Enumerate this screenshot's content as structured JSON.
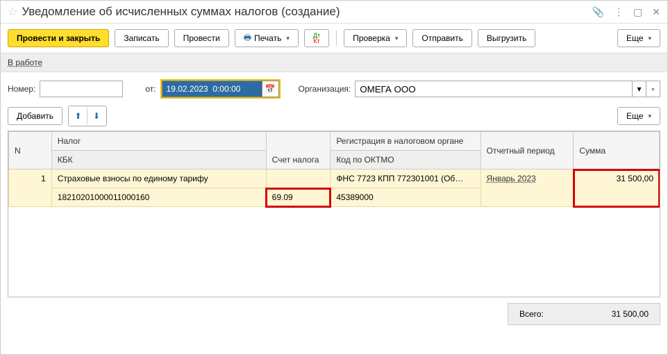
{
  "title": "Уведомление об исчисленных суммах налогов (создание)",
  "toolbar": {
    "submit_close": "Провести и закрыть",
    "save": "Записать",
    "submit": "Провести",
    "print": "Печать",
    "check": "Проверка",
    "send": "Отправить",
    "export": "Выгрузить",
    "more": "Еще"
  },
  "status": {
    "in_work": "В работе"
  },
  "fields": {
    "number_label": "Номер:",
    "number_value": "",
    "from_label": "от:",
    "date_value": "19.02.2023  0:00:00",
    "org_label": "Организация:",
    "org_value": "ОМЕГА ООО"
  },
  "tabletools": {
    "add": "Добавить",
    "more": "Еще"
  },
  "headers": {
    "n": "N",
    "tax": "Налог",
    "kbk": "КБК",
    "acct": "Счет налога",
    "reg": "Регистрация в налоговом органе",
    "oktmo": "Код по ОКТМО",
    "period": "Отчетный период",
    "sum": "Сумма"
  },
  "rows": [
    {
      "n": "1",
      "tax": "Страховые взносы по единому тарифу",
      "kbk": "18210201000011000160",
      "acct": "69.09",
      "reg": "ФНС 7723 КПП 772301001 (Об…",
      "oktmo": "45389000",
      "period": "Январь 2023",
      "sum": "31 500,00"
    }
  ],
  "footer": {
    "total_label": "Всего:",
    "total_value": "31 500,00"
  }
}
